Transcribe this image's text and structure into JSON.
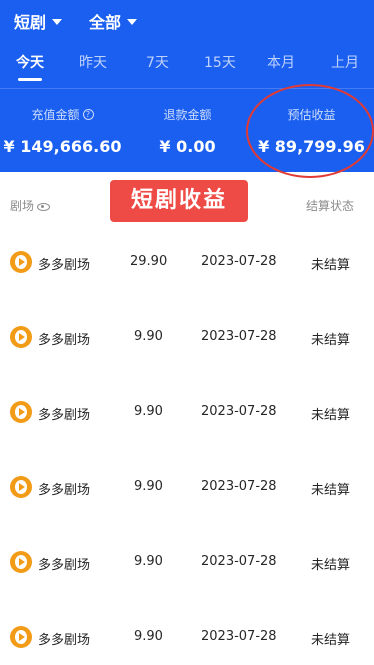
{
  "filters": {
    "category": "短剧",
    "scope": "全部"
  },
  "tabs": [
    "今天",
    "昨天",
    "7天",
    "15天",
    "本月",
    "上月"
  ],
  "active_tab": "今天",
  "stats": {
    "recharge_label": "充值金额",
    "recharge_value": "¥ 149,666.60",
    "refund_label": "退款金额",
    "refund_value": "¥ 0.00",
    "estimate_label": "预估收益",
    "estimate_value": "¥ 89,799.96"
  },
  "columns": {
    "theater": "剧场",
    "status": "结算状态"
  },
  "watermark": "短剧收益",
  "rows": [
    {
      "name": "多多剧场",
      "amount": "29.90",
      "date": "2023-07-28",
      "status": "未结算"
    },
    {
      "name": "多多剧场",
      "amount": "9.90",
      "date": "2023-07-28",
      "status": "未结算"
    },
    {
      "name": "多多剧场",
      "amount": "9.90",
      "date": "2023-07-28",
      "status": "未结算"
    },
    {
      "name": "多多剧场",
      "amount": "9.90",
      "date": "2023-07-28",
      "status": "未结算"
    },
    {
      "name": "多多剧场",
      "amount": "9.90",
      "date": "2023-07-28",
      "status": "未结算"
    },
    {
      "name": "多多剧场",
      "amount": "9.90",
      "date": "2023-07-28",
      "status": "未结算"
    }
  ],
  "colors": {
    "header_bg": "#1a5ff0",
    "accent_red": "#ef4b46",
    "logo_orange": "#f29b17"
  }
}
